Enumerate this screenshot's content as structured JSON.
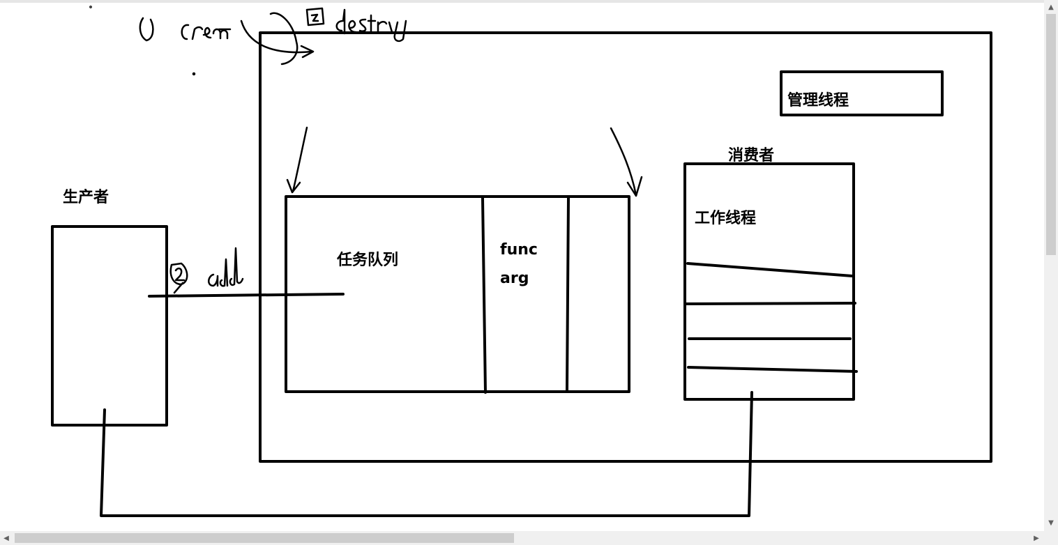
{
  "labels": {
    "producer": "生产者",
    "task_queue": "任务队列",
    "func": "func",
    "arg": "arg",
    "manager_thread": "管理线程",
    "consumer": "消费者",
    "worker_thread": "工作线程"
  },
  "handwritten": {
    "step1": "① create",
    "step2": "② add",
    "step3": "③ destroy"
  },
  "scrollbars": {
    "up_arrow": "▲",
    "down_arrow": "▼",
    "left_arrow": "◀",
    "right_arrow": "▶"
  },
  "colors": {
    "stroke": "#000000",
    "background": "#ffffff",
    "scrollbar_track": "#f0f0f0",
    "scrollbar_thumb": "#cdcdcd"
  }
}
